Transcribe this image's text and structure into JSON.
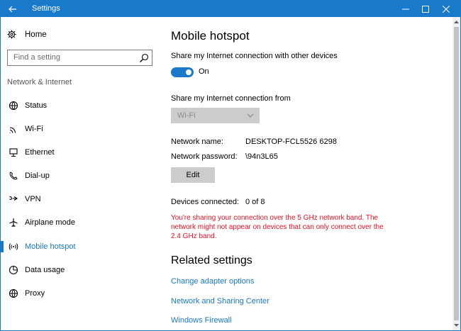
{
  "window": {
    "title": "Settings",
    "accent_color": "#1979ca"
  },
  "sidebar": {
    "home_label": "Home",
    "search_placeholder": "Find a setting",
    "section_label": "Network & Internet",
    "items": [
      {
        "label": "Status",
        "icon": "status-icon",
        "active": false
      },
      {
        "label": "Wi-Fi",
        "icon": "wifi-icon",
        "active": false
      },
      {
        "label": "Ethernet",
        "icon": "ethernet-icon",
        "active": false
      },
      {
        "label": "Dial-up",
        "icon": "dialup-icon",
        "active": false
      },
      {
        "label": "VPN",
        "icon": "vpn-icon",
        "active": false
      },
      {
        "label": "Airplane mode",
        "icon": "airplane-icon",
        "active": false
      },
      {
        "label": "Mobile hotspot",
        "icon": "hotspot-icon",
        "active": true
      },
      {
        "label": "Data usage",
        "icon": "data-usage-icon",
        "active": false
      },
      {
        "label": "Proxy",
        "icon": "proxy-icon",
        "active": false
      }
    ]
  },
  "main": {
    "title": "Mobile hotspot",
    "share_label": "Share my Internet connection with other devices",
    "toggle_state": "On",
    "share_from_label": "Share my Internet connection from",
    "share_from_value": "Wi-Fi",
    "network_name_label": "Network name:",
    "network_name_value": "DESKTOP-FCL5526 6298",
    "network_password_label": "Network password:",
    "network_password_value": "\\94n3L65",
    "edit_button": "Edit",
    "devices_label": "Devices connected:",
    "devices_value": "0 of 8",
    "warning": "You're sharing your connection over the 5 GHz network band. The network might not appear on devices that can only connect over the 2.4 GHz band.",
    "warning_color": "#e81123",
    "related_title": "Related settings",
    "links": [
      "Change adapter options",
      "Network and Sharing Center",
      "Windows Firewall"
    ]
  }
}
